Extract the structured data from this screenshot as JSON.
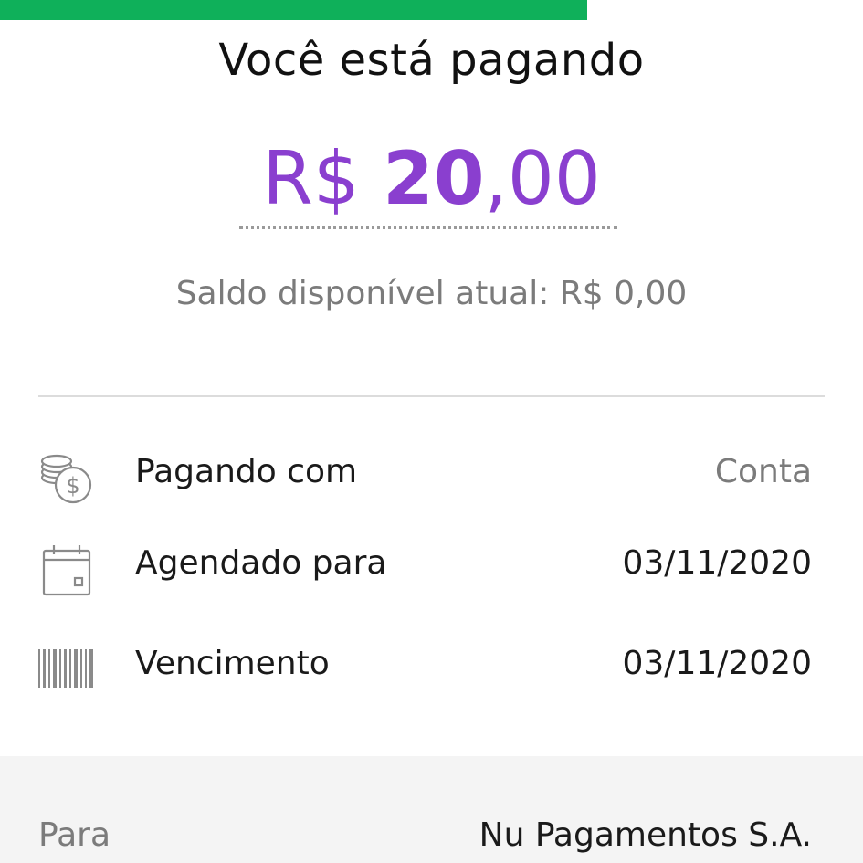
{
  "progress": {
    "fraction": 0.68,
    "color": "#0fb05a"
  },
  "header": {
    "title": "Você está pagando"
  },
  "amount": {
    "currency": "R$",
    "integer": "20",
    "decimal": ",00",
    "color": "#8a3fcf"
  },
  "balance": {
    "text": "Saldo disponível atual: R$ 0,00"
  },
  "details": {
    "paying_with": {
      "label": "Pagando com",
      "value": "Conta",
      "icon": "coins-icon"
    },
    "scheduled_for": {
      "label": "Agendado para",
      "value": "03/11/2020",
      "icon": "calendar-icon"
    },
    "due_date": {
      "label": "Vencimento",
      "value": "03/11/2020",
      "icon": "barcode-icon"
    }
  },
  "recipient": {
    "label": "Para",
    "value": "Nu Pagamentos S.A."
  }
}
